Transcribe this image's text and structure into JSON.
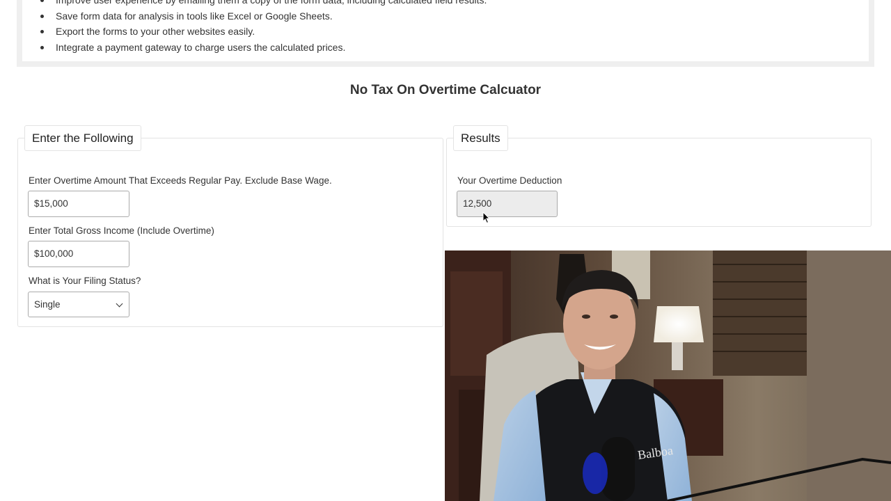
{
  "features": [
    "Improve user experience by emailing them a copy of the form data, including calculated field results.",
    "Save form data for analysis in tools like Excel or Google Sheets.",
    "Export the forms to your other websites easily.",
    "Integrate a payment gateway to charge users the calculated prices."
  ],
  "page_title": "No Tax On Overtime Calcuator",
  "input_panel": {
    "legend": "Enter the Following",
    "overtime_label": "Enter Overtime Amount That Exceeds Regular Pay. Exclude Base Wage.",
    "overtime_value": "$15,000",
    "income_label": "Enter Total Gross Income (Include Overtime)",
    "income_value": "$100,000",
    "filing_label": "What is Your Filing Status?",
    "filing_value": "Single"
  },
  "results_panel": {
    "legend": "Results",
    "deduction_label": "Your Overtime Deduction",
    "deduction_value": "12,500"
  },
  "webcam": {
    "vest_logo": "Balboa"
  },
  "colors": {
    "info_box_border": "#efefef",
    "readonly_bg": "#ececec",
    "panel_border": "#e3e3e3"
  }
}
